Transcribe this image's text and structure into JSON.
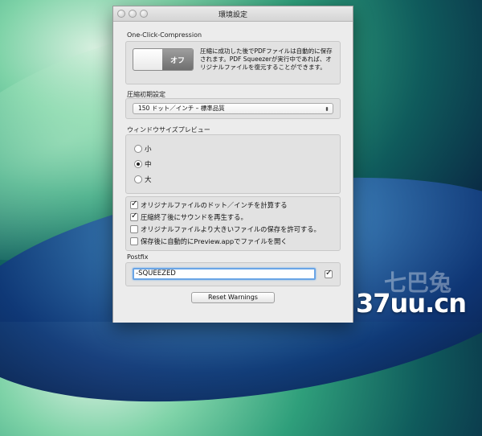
{
  "window": {
    "title": "環境設定"
  },
  "compression": {
    "section_label": "One-Click-Compression",
    "toggle_label": "オフ",
    "description": "圧縮に成功した後でPDFファイルは自動的に保存されます。PDF Squeezerが実行中であれば、オリジナルファイルを復元することができます。"
  },
  "initial_settings": {
    "section_label": "圧縮初期設定",
    "selected_value": "150 ドット／インチ – 標準品質"
  },
  "preview": {
    "section_label": "ウィンドウサイズプレビュー",
    "options": [
      {
        "label": "小",
        "selected": false
      },
      {
        "label": "中",
        "selected": true
      },
      {
        "label": "大",
        "selected": false
      }
    ]
  },
  "options": {
    "items": [
      {
        "label": "オリジナルファイルのドット／インチを計算する",
        "checked": true
      },
      {
        "label": "圧縮終了後にサウンドを再生する。",
        "checked": true
      },
      {
        "label": "オリジナルファイルより大きいファイルの保存を許可する。",
        "checked": false
      },
      {
        "label": "保存後に自動的にPreview.appでファイルを開く",
        "checked": false
      }
    ]
  },
  "postfix": {
    "section_label": "Postfix",
    "value": "-SQUEEZED",
    "checked": true
  },
  "reset_button_label": "Reset Warnings",
  "watermark": {
    "logo_text": "七巴兔",
    "site": "37uu.cn"
  }
}
